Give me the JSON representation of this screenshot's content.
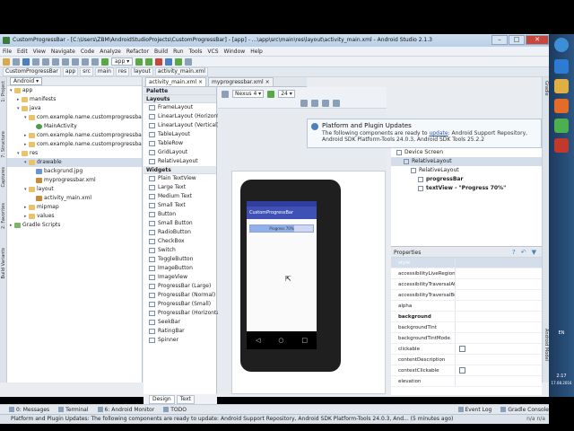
{
  "window": {
    "title": "CustomProgressBar - [C:\\Users\\ZBM\\AndroidStudioProjects\\CustomProgressBar] - [app] - ...\\app\\src\\main\\res\\layout\\activity_main.xml - Android Studio 2.1.3",
    "buttons": {
      "min": "–",
      "max": "□",
      "close": "✕"
    }
  },
  "menu": [
    "File",
    "Edit",
    "View",
    "Navigate",
    "Code",
    "Analyze",
    "Refactor",
    "Build",
    "Run",
    "Tools",
    "VCS",
    "Window",
    "Help"
  ],
  "toolbar": {
    "run_config": "app ▾"
  },
  "breadcrumb": [
    "CustomProgressBar",
    "app",
    "src",
    "main",
    "res",
    "layout",
    "activity_main.xml"
  ],
  "left_strip": [
    "1: Project",
    "7: Structure",
    "Captures",
    "2: Favorites",
    "Build Variants"
  ],
  "right_strip": [
    "Gradle",
    "Android Model"
  ],
  "project": {
    "view": "Android ▾",
    "tree": [
      {
        "label": "app",
        "indent": 0,
        "icon": "f",
        "arrow": "▾"
      },
      {
        "label": "manifests",
        "indent": 1,
        "icon": "f",
        "arrow": "▸"
      },
      {
        "label": "java",
        "indent": 1,
        "icon": "f",
        "arrow": "▾"
      },
      {
        "label": "com.example.name.customprogressbar",
        "indent": 2,
        "icon": "f",
        "arrow": "▾"
      },
      {
        "label": "MainActivity",
        "indent": 3,
        "icon": "c",
        "arrow": ""
      },
      {
        "label": "com.example.name.customprogressbar",
        "indent": 2,
        "icon": "f",
        "arrow": "▸"
      },
      {
        "label": "com.example.name.customprogressbar",
        "indent": 2,
        "icon": "f",
        "arrow": "▸"
      },
      {
        "label": "res",
        "indent": 1,
        "icon": "f",
        "arrow": "▾"
      },
      {
        "label": "drawable",
        "indent": 2,
        "icon": "f",
        "arrow": "▾",
        "sel": true
      },
      {
        "label": "backgrund.jpg",
        "indent": 3,
        "icon": "j",
        "arrow": ""
      },
      {
        "label": "myprogressbar.xml",
        "indent": 3,
        "icon": "x",
        "arrow": ""
      },
      {
        "label": "layout",
        "indent": 2,
        "icon": "f",
        "arrow": "▾"
      },
      {
        "label": "activity_main.xml",
        "indent": 3,
        "icon": "x",
        "arrow": ""
      },
      {
        "label": "mipmap",
        "indent": 2,
        "icon": "f",
        "arrow": "▸"
      },
      {
        "label": "values",
        "indent": 2,
        "icon": "f",
        "arrow": "▸"
      },
      {
        "label": "Gradle Scripts",
        "indent": 0,
        "icon": "g",
        "arrow": "▸"
      }
    ]
  },
  "editor_tabs": [
    {
      "label": "activity_main.xml ×",
      "active": true
    },
    {
      "label": "myprogressbar.xml ×",
      "active": false
    }
  ],
  "palette": {
    "title": "Palette",
    "sections": [
      {
        "name": "Layouts",
        "items": [
          "FrameLayout",
          "LinearLayout (Horizontal)",
          "LinearLayout (Vertical)",
          "TableLayout",
          "TableRow",
          "GridLayout",
          "RelativeLayout"
        ]
      },
      {
        "name": "Widgets",
        "items": [
          "Plain TextView",
          "Large Text",
          "Medium Text",
          "Small Text",
          "Button",
          "Small Button",
          "RadioButton",
          "CheckBox",
          "Switch",
          "ToggleButton",
          "ImageButton",
          "ImageView",
          "ProgressBar (Large)",
          "ProgressBar (Normal)",
          "ProgressBar (Small)",
          "ProgressBar (Horizontal)",
          "SeekBar",
          "RatingBar",
          "Spinner"
        ]
      }
    ]
  },
  "design_tabs": [
    {
      "label": "Design",
      "active": true
    },
    {
      "label": "Text",
      "active": false
    }
  ],
  "canvas_toolbar": {
    "device": "Nexus 4 ▾",
    "api": "24 ▾"
  },
  "preview": {
    "app_title": "CustomProgressBar",
    "progress_text": "Progress 70%",
    "progress": 0.7,
    "nav": [
      "◁",
      "○",
      "□"
    ]
  },
  "notification": {
    "title": "Platform and Plugin Updates",
    "msg_pre": "The following components are ready to ",
    "msg_link": "update",
    "msg_post": ": Android Support Repository, Android SDK Platform-Tools 24.0.3, Android SDK Tools 25.2.2"
  },
  "component_tree": [
    {
      "label": "Device Screen",
      "indent": 0
    },
    {
      "label": "RelativeLayout",
      "indent": 1,
      "sel": true
    },
    {
      "label": "RelativeLayout",
      "indent": 2
    },
    {
      "label": "progressBar",
      "indent": 3,
      "b": true
    },
    {
      "label": "textView - \"Progress 70%\"",
      "indent": 3,
      "b": true
    }
  ],
  "properties": {
    "title": "Properties",
    "rows": [
      {
        "k": "style",
        "hl": true
      },
      {
        "k": "accessibilityLiveRegion"
      },
      {
        "k": "accessibilityTraversalAfter"
      },
      {
        "k": "accessibilityTraversalBefore"
      },
      {
        "k": "alpha"
      },
      {
        "k": "background",
        "b": true
      },
      {
        "k": "backgroundTint"
      },
      {
        "k": "backgroundTintMode"
      },
      {
        "k": "clickable",
        "cb": true
      },
      {
        "k": "contentDescription"
      },
      {
        "k": "contextClickable",
        "cb": true
      },
      {
        "k": "elevation"
      }
    ]
  },
  "bottom_tools": [
    "0: Messages",
    "Terminal",
    "6: Android Monitor",
    "TODO",
    "Event Log",
    "Gradle Console"
  ],
  "status": {
    "text": "Platform and Plugin Updates: The following components are ready to update: Android Support Repository, Android SDK Platform-Tools 24.0.3, And... (5 minutes ago)",
    "right": "n/a   n/a"
  },
  "tray": {
    "lang": "EN",
    "time": "2:17",
    "date": "17.08.2016"
  }
}
